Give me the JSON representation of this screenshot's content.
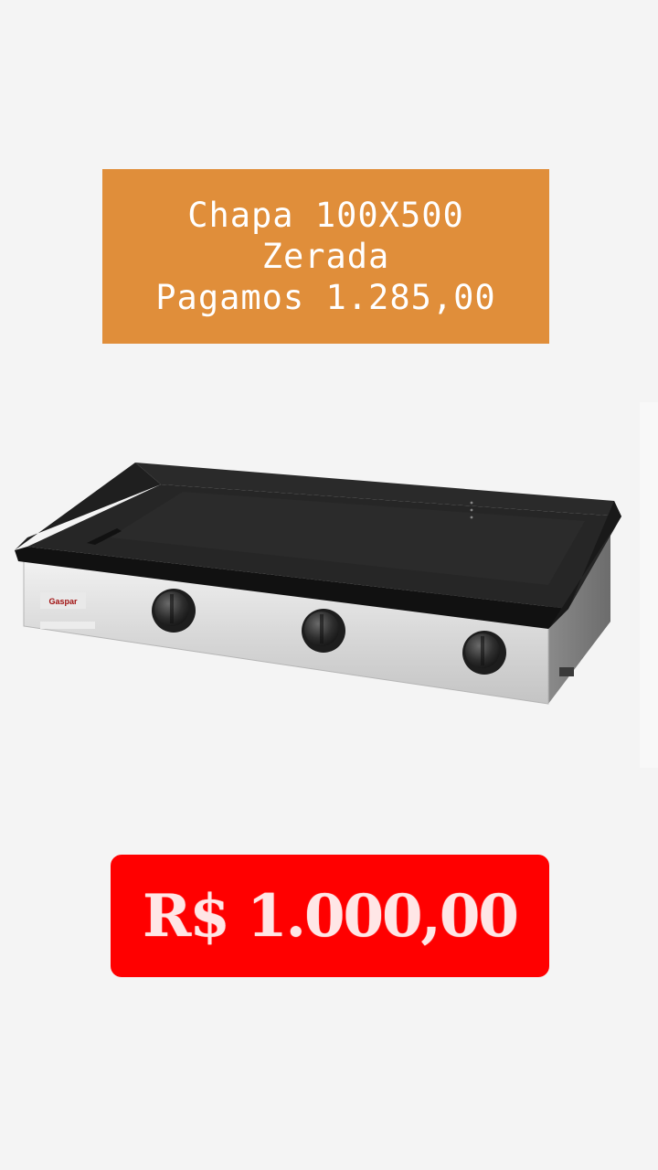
{
  "offer_card": {
    "lines": [
      "Chapa 100X500",
      "Zerada",
      "Pagamos 1.285,00"
    ],
    "background_color": "#e08e3a"
  },
  "product": {
    "brand_logo_text": "Gaspar",
    "image_alt": "Chapa a gás com três queimadores"
  },
  "price_tag": {
    "text": "R$ 1.000,00",
    "background_color": "#ff0000"
  }
}
